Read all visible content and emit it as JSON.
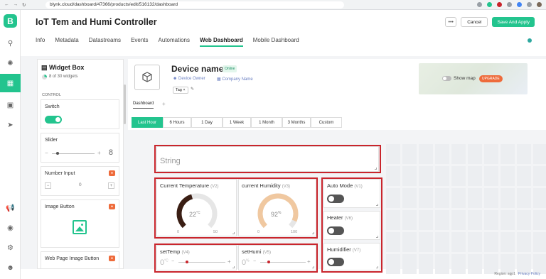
{
  "browser": {
    "url": "blynk.cloud/dashboard/47366/products/edit/516132/dashboard"
  },
  "app": {
    "logo": "B",
    "title": "IoT Tem and Humi Controller",
    "more_label": "•••",
    "cancel_label": "Cancel",
    "save_label": "Save And Apply"
  },
  "tabs": [
    {
      "label": "Info"
    },
    {
      "label": "Metadata"
    },
    {
      "label": "Datastreams"
    },
    {
      "label": "Events"
    },
    {
      "label": "Automations"
    },
    {
      "label": "Web Dashboard"
    },
    {
      "label": "Mobile Dashboard"
    }
  ],
  "widget_box": {
    "title": "Widget Box",
    "count": "8 of 30 widgets",
    "used_fraction": 0.27,
    "section": "CONTROL",
    "items": [
      {
        "label": "Switch"
      },
      {
        "label": "Slider",
        "value": "8"
      },
      {
        "label": "Number Input",
        "value": "0"
      },
      {
        "label": "Image Button"
      },
      {
        "label": "Web Page Image Button"
      }
    ]
  },
  "device": {
    "name": "Device name",
    "status": "Online",
    "owner": "Device Owner",
    "company": "Company Name",
    "tag": "Tag",
    "show_map": "Show map",
    "upgrade": "UPGRADE"
  },
  "dashboard_tab": "Dashboard",
  "time_ranges": [
    "Last Hour",
    "6 Hours",
    "1 Day",
    "1 Week",
    "1 Month",
    "3 Months",
    "Custom"
  ],
  "widgets": {
    "string": {
      "label": "String"
    },
    "temp": {
      "label": "Current Temperature",
      "pin": "(V2)",
      "value": "22",
      "unit": "°C",
      "min": "0",
      "max": "50",
      "fraction": 0.44,
      "color": "#3a1e14"
    },
    "humi": {
      "label": "current Humidity",
      "pin": "(V3)",
      "value": "92",
      "unit": "%",
      "min": "0",
      "max": "100",
      "fraction": 0.92,
      "color": "#f0c8a0"
    },
    "set_temp": {
      "label": "setTemp",
      "pin": "(V4)",
      "value": "0",
      "unit": "°C"
    },
    "set_humi": {
      "label": "setHumi",
      "pin": "(V5)",
      "value": "0",
      "unit": "%"
    },
    "auto_mode": {
      "label": "Auto Mode",
      "pin": "(V1)"
    },
    "heater": {
      "label": "Heater",
      "pin": "(V6)"
    },
    "humidifier": {
      "label": "Humidifier",
      "pin": "(V7)"
    }
  },
  "footer": {
    "region": "Region: sgp1",
    "privacy": "Privacy Policy"
  },
  "colors": {
    "accent": "#23c48e",
    "highlight": "#c9252c"
  }
}
